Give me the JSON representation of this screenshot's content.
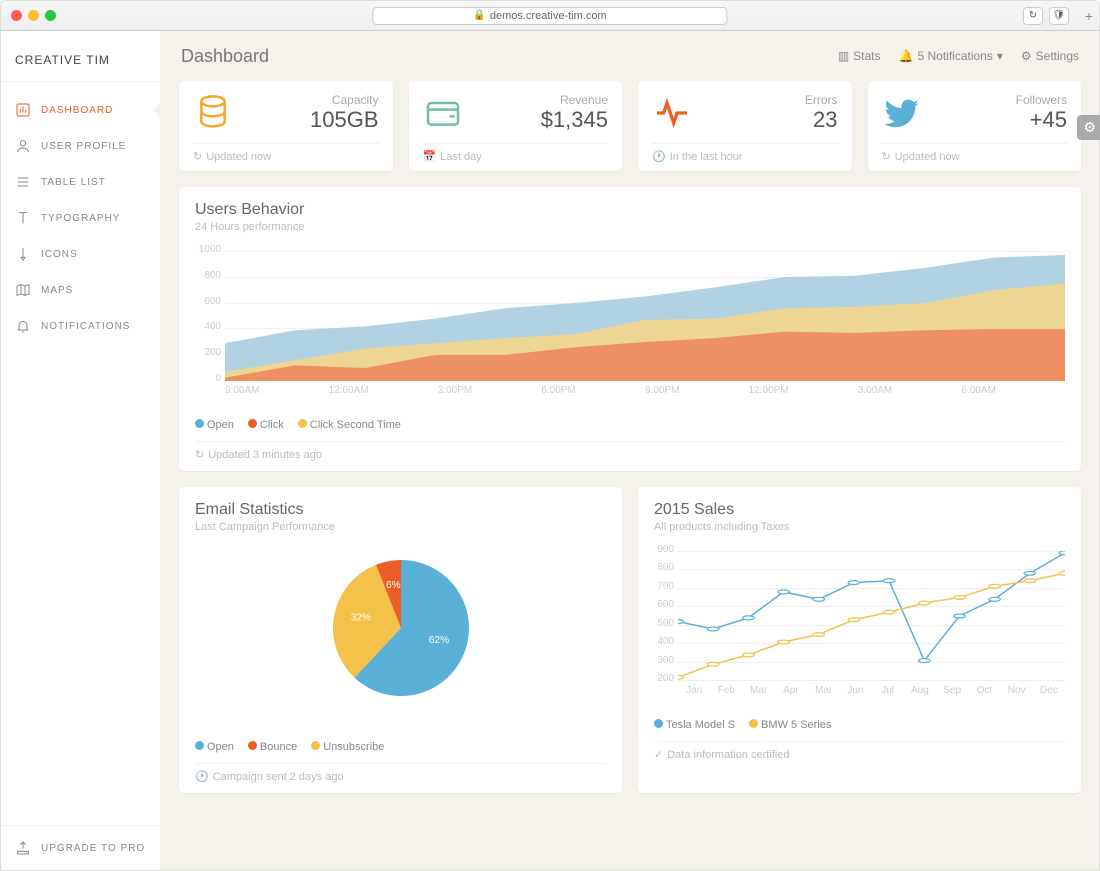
{
  "browser": {
    "url": "demos.creative-tim.com"
  },
  "brand": "CREATIVE TIM",
  "page_title": "Dashboard",
  "topbar": {
    "stats": "Stats",
    "notifications": "5 Notifications",
    "settings": "Settings"
  },
  "sidebar": {
    "items": [
      {
        "label": "DASHBOARD"
      },
      {
        "label": "USER PROFILE"
      },
      {
        "label": "TABLE LIST"
      },
      {
        "label": "TYPOGRAPHY"
      },
      {
        "label": "ICONS"
      },
      {
        "label": "MAPS"
      },
      {
        "label": "NOTIFICATIONS"
      }
    ],
    "footer": "UPGRADE TO PRO"
  },
  "stats": [
    {
      "label": "Capacity",
      "value": "105GB",
      "footer": "Updated now",
      "icon": "database",
      "color": "#f4a82a"
    },
    {
      "label": "Revenue",
      "value": "$1,345",
      "footer": "Last day",
      "icon": "wallet",
      "color": "#6dc39a"
    },
    {
      "label": "Errors",
      "value": "23",
      "footer": "In the last hour",
      "icon": "pulse",
      "color": "#eb5e28"
    },
    {
      "label": "Followers",
      "value": "+45",
      "footer": "Updated now",
      "icon": "twitter",
      "color": "#5bb0d8"
    }
  ],
  "behavior": {
    "title": "Users Behavior",
    "subtitle": "24 Hours performance",
    "legend": [
      {
        "label": "Open",
        "color": "#5bb0d8"
      },
      {
        "label": "Click",
        "color": "#eb5e28"
      },
      {
        "label": "Click Second Time",
        "color": "#f4c24a"
      }
    ],
    "footer": "Updated 3 minutes ago"
  },
  "email": {
    "title": "Email Statistics",
    "subtitle": "Last Campaign Performance",
    "legend": [
      {
        "label": "Open",
        "color": "#5bb0d8"
      },
      {
        "label": "Bounce",
        "color": "#eb5e28"
      },
      {
        "label": "Unsubscribe",
        "color": "#f4c24a"
      }
    ],
    "footer": "Campaign sent 2 days ago"
  },
  "sales": {
    "title": "2015 Sales",
    "subtitle": "All products including Taxes",
    "legend": [
      {
        "label": "Tesla Model S",
        "color": "#5bb0d8"
      },
      {
        "label": "BMW 5 Series",
        "color": "#f4c24a"
      }
    ],
    "footer": "Data information certified"
  },
  "chart_data": [
    {
      "id": "behavior",
      "type": "area",
      "title": "Users Behavior",
      "subtitle": "24 Hours performance",
      "x": [
        "9:00AM",
        "12:00AM",
        "3:00PM",
        "6:00PM",
        "9:00PM",
        "12:00PM",
        "3:00AM",
        "6:00AM",
        ""
      ],
      "ylim": [
        0,
        1000
      ],
      "yticks": [
        0,
        200,
        400,
        600,
        800,
        1000
      ],
      "series": [
        {
          "name": "Open",
          "color": "#5bb0d8",
          "values": [
            290,
            390,
            420,
            480,
            560,
            600,
            650,
            720,
            800,
            810,
            870,
            950,
            970
          ]
        },
        {
          "name": "Click Second Time",
          "color": "#f4c24a",
          "values": [
            70,
            160,
            250,
            290,
            330,
            360,
            470,
            480,
            560,
            570,
            600,
            700,
            750
          ]
        },
        {
          "name": "Click",
          "color": "#eb5e28",
          "values": [
            25,
            120,
            100,
            200,
            200,
            260,
            300,
            330,
            380,
            370,
            390,
            400,
            400
          ]
        }
      ]
    },
    {
      "id": "email",
      "type": "pie",
      "title": "Email Statistics",
      "series": [
        {
          "name": "Open",
          "value": 62,
          "color": "#5bb0d8"
        },
        {
          "name": "Unsubscribe",
          "value": 32,
          "color": "#f4c24a"
        },
        {
          "name": "Bounce",
          "value": 6,
          "color": "#eb5e28"
        }
      ]
    },
    {
      "id": "sales",
      "type": "line",
      "title": "2015 Sales",
      "x": [
        "Jan",
        "Feb",
        "Mar",
        "Apr",
        "Mai",
        "Jun",
        "Jul",
        "Aug",
        "Sep",
        "Oct",
        "Nov",
        "Dec"
      ],
      "ylim": [
        200,
        900
      ],
      "yticks": [
        200,
        300,
        400,
        500,
        600,
        700,
        800,
        900
      ],
      "series": [
        {
          "name": "Tesla Model S",
          "color": "#5bb0d8",
          "values": [
            520,
            480,
            540,
            680,
            640,
            730,
            740,
            310,
            550,
            640,
            780,
            890
          ]
        },
        {
          "name": "BMW 5 Series",
          "color": "#f4c24a",
          "values": [
            220,
            290,
            340,
            410,
            450,
            530,
            570,
            620,
            650,
            710,
            740,
            780
          ]
        }
      ]
    }
  ]
}
